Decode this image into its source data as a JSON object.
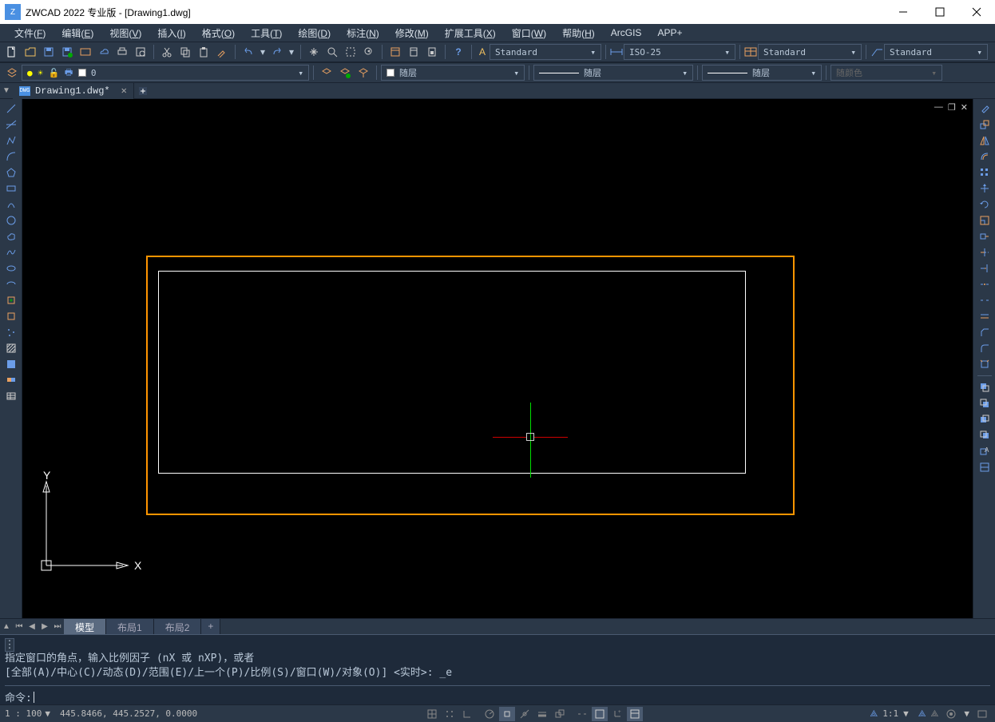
{
  "window": {
    "title": "ZWCAD 2022 专业版 - [Drawing1.dwg]"
  },
  "menus": [
    {
      "label": "文件",
      "key": "F"
    },
    {
      "label": "编辑",
      "key": "E"
    },
    {
      "label": "视图",
      "key": "V"
    },
    {
      "label": "插入",
      "key": "I"
    },
    {
      "label": "格式",
      "key": "O"
    },
    {
      "label": "工具",
      "key": "T"
    },
    {
      "label": "绘图",
      "key": "D"
    },
    {
      "label": "标注",
      "key": "N"
    },
    {
      "label": "修改",
      "key": "M"
    },
    {
      "label": "扩展工具",
      "key": "X"
    },
    {
      "label": "窗口",
      "key": "W"
    },
    {
      "label": "帮助",
      "key": "H"
    },
    {
      "label": "ArcGIS",
      "key": ""
    },
    {
      "label": "APP+",
      "key": ""
    }
  ],
  "toolbar1_dropdowns": {
    "text_style": "Standard",
    "dim_style": "ISO-25",
    "table_style": "Standard",
    "mleader_style": "Standard"
  },
  "toolbar2": {
    "layer_value": "0",
    "color_label": "随层",
    "linetype_label": "随层",
    "lineweight_label": "随层",
    "plotstyle_label": "随颜色"
  },
  "file_tab": {
    "name": "Drawing1.dwg*",
    "icon_label": "DWG"
  },
  "layout_tabs": [
    "模型",
    "布局1",
    "布局2"
  ],
  "cmd": {
    "line1": "指定窗口的角点，输入比例因子 (nX 或 nXP)，或者",
    "line2": "[全部(A)/中心(C)/动态(D)/范围(E)/上一个(P)/比例(S)/窗口(W)/对象(O)] <实时>: _e",
    "prompt": "命令: "
  },
  "status": {
    "scale": "1 : 100",
    "coords": "445.8466, 445.2527, 0.0000",
    "anno_scale": "1:1"
  },
  "ucs": {
    "x_label": "X",
    "y_label": "Y"
  }
}
